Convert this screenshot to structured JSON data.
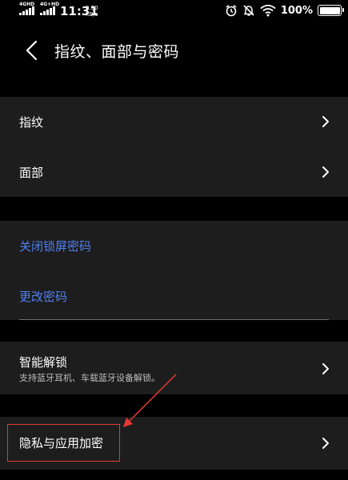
{
  "status_bar": {
    "signal_1_label": "4GHD",
    "signal_2_label": "4G+HD",
    "time": "11:31",
    "net_speed_value": "0.50",
    "net_speed_unit": "KB/s",
    "battery_percent": "100%",
    "icons": [
      "signal-icon",
      "alarm-icon",
      "mute-icon",
      "wifi-icon",
      "battery-icon"
    ]
  },
  "header": {
    "back_icon": "chevron-left-icon",
    "title": "指纹、面部与密码"
  },
  "biometrics_group": {
    "items": [
      {
        "label": "指纹"
      },
      {
        "label": "面部"
      }
    ]
  },
  "password_group": {
    "items": [
      {
        "label": "关闭锁屏密码"
      },
      {
        "label": "更改密码"
      }
    ]
  },
  "smart_unlock": {
    "label": "智能解锁",
    "description": "支持蓝牙耳机、车载蓝牙设备解锁。"
  },
  "privacy": {
    "label": "隐私与应用加密"
  },
  "colors": {
    "background": "#000000",
    "card": "#1d1d1d",
    "link_blue": "#4f7ff2",
    "annotation_red": "#e53935"
  }
}
